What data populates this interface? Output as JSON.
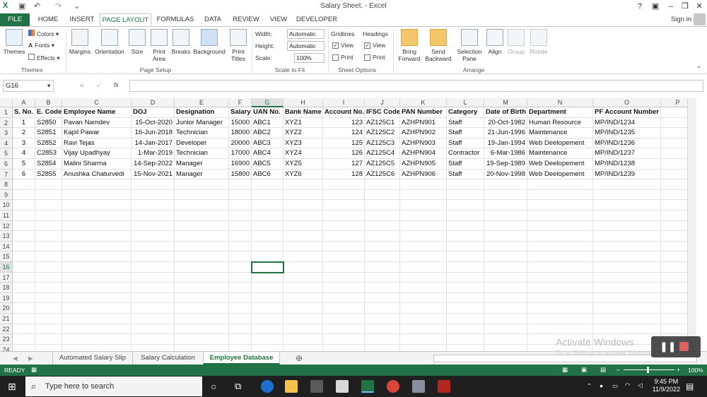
{
  "window": {
    "title": "Salary Sheet. - Excel",
    "help": "?",
    "signin": "Sign in"
  },
  "tabs": [
    "FILE",
    "HOME",
    "INSERT",
    "PAGE LAYOUT",
    "FORMULAS",
    "DATA",
    "REVIEW",
    "VIEW",
    "DEVELOPER"
  ],
  "ribbon": {
    "themes": {
      "themes": "Themes",
      "colors": "Colors",
      "fonts": "Fonts",
      "effects": "Effects",
      "group": "Themes"
    },
    "page_setup": {
      "margins": "Margins",
      "orientation": "Orientation",
      "size": "Size",
      "print_area": "Print Area",
      "breaks": "Breaks",
      "background": "Background",
      "print_titles": "Print Titles",
      "group": "Page Setup"
    },
    "scale": {
      "width_label": "Width:",
      "width_value": "Automatic",
      "height_label": "Height:",
      "height_value": "Automatic",
      "scale_label": "Scale:",
      "scale_value": "100%",
      "group": "Scale to Fit"
    },
    "sheet_options": {
      "gridlines": "Gridlines",
      "headings": "Headings",
      "view": "View",
      "print": "Print",
      "group": "Sheet Options"
    },
    "arrange": {
      "bring_forward": "Bring Forward",
      "send_backward": "Send Backward",
      "selection_pane": "Selection Pane",
      "align": "Align",
      "group_btn": "Group",
      "rotate": "Rotate",
      "group": "Arrange"
    }
  },
  "formula_bar": {
    "name_box": "G16",
    "fx": "fx",
    "cancel": "✕",
    "enter": "✓",
    "value": ""
  },
  "columns": [
    "A",
    "B",
    "C",
    "D",
    "E",
    "F",
    "G",
    "H",
    "I",
    "J",
    "K",
    "L",
    "M",
    "N",
    "O",
    "P"
  ],
  "rows": [
    "1",
    "2",
    "3",
    "4",
    "5",
    "6",
    "7",
    "8",
    "9",
    "10",
    "11",
    "12",
    "13",
    "14",
    "15",
    "16",
    "17",
    "18",
    "19",
    "20",
    "21",
    "22",
    "23",
    "24"
  ],
  "selected_col": "G",
  "selected_row": "16",
  "table": {
    "headers": [
      "S. No.",
      "E. Code",
      "Employee Name",
      "DOJ",
      "Designation",
      "Salary",
      "UAN No.",
      "Bank Name",
      "Account No.",
      "IFSC Code",
      "PAN Number",
      "Category",
      "Date of Birth",
      "Department",
      "PF Account Number"
    ],
    "rows": [
      [
        "1",
        "S2850",
        "Pavan Namdev",
        "15-Oct-2020",
        "Junior Manager",
        "15000",
        "ABC1",
        "XYZ1",
        "123",
        "AZ125C1",
        "AZHPN901",
        "Staff",
        "20-Oct-1982",
        "Human Resource",
        "MP/IND/1234"
      ],
      [
        "2",
        "S2851",
        "Kapil Pawar",
        "16-Jun-2018",
        "Technician",
        "18000",
        "ABC2",
        "XYZ2",
        "124",
        "AZ125C2",
        "AZHPN902",
        "Staff",
        "21-Jun-1996",
        "Maintenance",
        "MP/IND/1235"
      ],
      [
        "3",
        "S2852",
        "Ravi Tejas",
        "14-Jan-2017",
        "Developer",
        "20000",
        "ABC3",
        "XYZ3",
        "125",
        "AZ125C3",
        "AZHPN903",
        "Staff",
        "19-Jan-1994",
        "Web Deelopement",
        "MP/IND/1236"
      ],
      [
        "4",
        "C2853",
        "Vijay Upadhyay",
        "1-Mar-2019",
        "Technician",
        "17000",
        "ABC4",
        "XYZ4",
        "126",
        "AZ125C4",
        "AZHPN904",
        "Contractor",
        "6-Mar-1986",
        "Maintenance",
        "MP/IND/1237"
      ],
      [
        "5",
        "S2854",
        "Malini Sharma",
        "14-Sep-2022",
        "Manager",
        "16900",
        "ABC5",
        "XYZ5",
        "127",
        "AZ125C5",
        "AZHPN905",
        "Staff",
        "19-Sep-1989",
        "Web Deelopement",
        "MP/IND/1238"
      ],
      [
        "6",
        "S2855",
        "Anushka Chaturvedi",
        "15-Nov-2021",
        "Manager",
        "15800",
        "ABC6",
        "XYZ6",
        "128",
        "AZ125C6",
        "AZHPN906",
        "Staff",
        "20-Nov-1998",
        "Web Deelopement",
        "MP/IND/1239"
      ]
    ]
  },
  "sheet_tabs": [
    "Automated Salary Slip",
    "Salary Calculation",
    "Employee Database"
  ],
  "active_sheet": "Employee Database",
  "status": {
    "ready": "READY",
    "zoom": "100%"
  },
  "watermark": {
    "line1": "Activate Windows",
    "line2": "Go to Settings to activate Windows."
  },
  "taskbar": {
    "search_placeholder": "Type here to search",
    "time": "9:45 PM",
    "date": "11/9/2022"
  },
  "colors": {
    "excel_green": "#217346",
    "taskbar": "#1f1f1f"
  }
}
